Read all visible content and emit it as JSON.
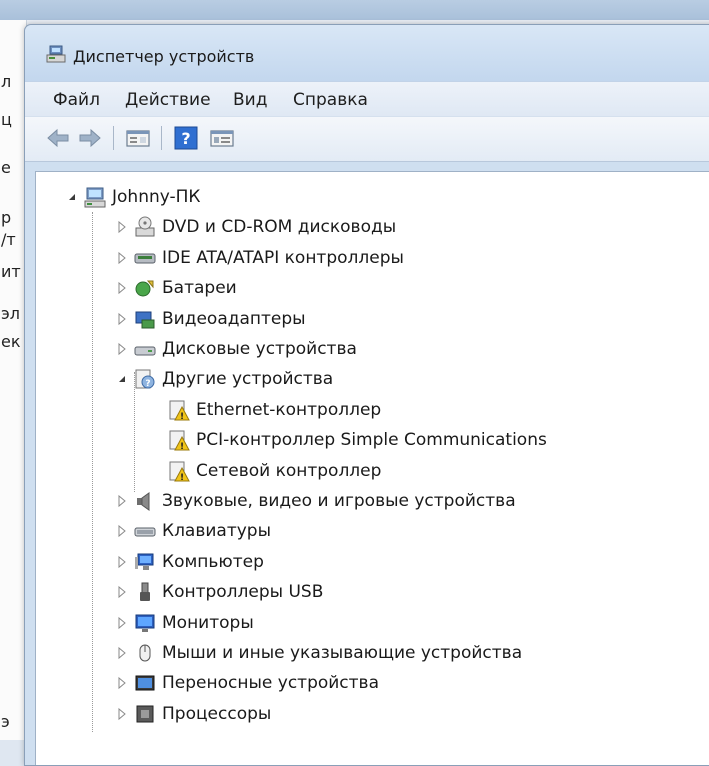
{
  "window": {
    "title": "Диспетчер устройств"
  },
  "menu": [
    "Файл",
    "Действие",
    "Вид",
    "Справка"
  ],
  "toolbar": {
    "buttons": [
      "back-icon",
      "forward-icon",
      "properties-icon",
      "help-icon",
      "view-icon"
    ]
  },
  "background": {
    "left_chars": [
      "л",
      "ц",
      "е",
      "р",
      "/т",
      "ит",
      "эл",
      "ек",
      "э"
    ]
  },
  "tree": {
    "root": "Johnny-ПК",
    "categories": [
      {
        "label": "DVD и CD-ROM дисководы",
        "icon": "dvd-drive-icon",
        "expanded": false
      },
      {
        "label": "IDE ATA/ATAPI контроллеры",
        "icon": "ide-controller-icon",
        "expanded": false
      },
      {
        "label": "Батареи",
        "icon": "battery-icon",
        "expanded": false
      },
      {
        "label": "Видеоадаптеры",
        "icon": "display-adapter-icon",
        "expanded": false
      },
      {
        "label": "Дисковые устройства",
        "icon": "disk-drive-icon",
        "expanded": false
      },
      {
        "label": "Другие устройства",
        "icon": "unknown-device-icon",
        "expanded": true,
        "children": [
          {
            "label": "Ethernet-контроллер",
            "icon": "warning-device-icon"
          },
          {
            "label": "PCI-контроллер Simple Communications",
            "icon": "warning-device-icon"
          },
          {
            "label": "Сетевой контроллер",
            "icon": "warning-device-icon"
          }
        ]
      },
      {
        "label": "Звуковые, видео и игровые устройства",
        "icon": "speaker-icon",
        "expanded": false
      },
      {
        "label": "Клавиатуры",
        "icon": "keyboard-icon",
        "expanded": false
      },
      {
        "label": "Компьютер",
        "icon": "computer-icon",
        "expanded": false
      },
      {
        "label": "Контроллеры USB",
        "icon": "usb-icon",
        "expanded": false
      },
      {
        "label": "Мониторы",
        "icon": "monitor-icon",
        "expanded": false
      },
      {
        "label": "Мыши и иные указывающие устройства",
        "icon": "mouse-icon",
        "expanded": false
      },
      {
        "label": "Переносные устройства",
        "icon": "portable-device-icon",
        "expanded": false
      },
      {
        "label": "Процессоры",
        "icon": "processor-icon",
        "expanded": false
      }
    ]
  }
}
